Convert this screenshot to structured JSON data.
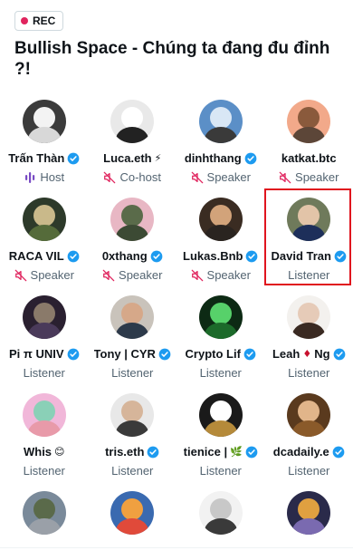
{
  "rec_badge": {
    "label": "REC",
    "dot_color": "#e0245e"
  },
  "space_title": "Bullish Space - Chúng ta đang đu đỉnh ?!",
  "colors": {
    "verified": "#1d9bf0",
    "host_accent": "#794bc4",
    "muted": "#536471",
    "highlight": "#e0141e"
  },
  "participants": [
    {
      "name": "Trấn Thàn",
      "role": "Host",
      "role_icon": "host-speaking-bars-icon",
      "verified": true,
      "avatar": [
        "#3b3b3b",
        "#f3f3f3",
        "#d8d8d8"
      ]
    },
    {
      "name": "Luca.eth",
      "emoji": "⚡",
      "role": "Co-host",
      "role_icon": "mic-muted-icon",
      "verified": false,
      "avatar": [
        "#e9e9e9",
        "#ffffff",
        "#222222"
      ]
    },
    {
      "name": "dinhthang",
      "role": "Speaker",
      "role_icon": "mic-muted-icon",
      "verified": true,
      "avatar": [
        "#5b8fc7",
        "#d9e7f5",
        "#3a3a3a"
      ]
    },
    {
      "name": "katkat.btc",
      "role": "Speaker",
      "role_icon": "mic-muted-icon",
      "verified": false,
      "avatar": [
        "#f2a98a",
        "#8a5a3c",
        "#5c4638"
      ]
    },
    {
      "name": "RACA VIL",
      "role": "Speaker",
      "role_icon": "mic-muted-icon",
      "verified": true,
      "avatar": [
        "#2d3a2a",
        "#c9b98a",
        "#556b3a"
      ]
    },
    {
      "name": "0xthang",
      "role": "Speaker",
      "role_icon": "mic-muted-icon",
      "verified": true,
      "avatar": [
        "#e8b7c4",
        "#5a6b4a",
        "#3c4a34"
      ]
    },
    {
      "name": "Lukas.Bnb",
      "role": "Speaker",
      "role_icon": "mic-muted-icon",
      "verified": true,
      "avatar": [
        "#3a2c22",
        "#d2a37a",
        "#2a2420"
      ]
    },
    {
      "name": "David Tran",
      "role": "Listener",
      "verified": true,
      "avatar": [
        "#6f7a5b",
        "#e2c4a8",
        "#1d2f5a"
      ]
    },
    {
      "name": "Pi π UNIV",
      "role": "Listener",
      "verified": true,
      "avatar": [
        "#2a2030",
        "#8a7a6a",
        "#4a3a5a"
      ]
    },
    {
      "name": "Tony | CYR",
      "role": "Listener",
      "verified": true,
      "avatar": [
        "#c9c3bb",
        "#d6a889",
        "#2d3a4a"
      ]
    },
    {
      "name": "Crypto Lif",
      "role": "Listener",
      "verified": true,
      "avatar": [
        "#0d2a14",
        "#57d16a",
        "#1c6a2a"
      ]
    },
    {
      "name": "Leah",
      "emoji": "♦",
      "name_suffix": "Ng",
      "role": "Listener",
      "verified": true,
      "avatar": [
        "#f3f1ee",
        "#e6cbb8",
        "#3a2a22"
      ]
    },
    {
      "name": "Whis",
      "emoji": "😊",
      "role": "Listener",
      "verified": false,
      "avatar": [
        "#f1b7d9",
        "#8ad0b7",
        "#e89aa9"
      ]
    },
    {
      "name": "tris.eth",
      "role": "Listener",
      "verified": true,
      "avatar": [
        "#e8e8e8",
        "#d6b59a",
        "#3a3a3a"
      ]
    },
    {
      "name": "tienice |",
      "emoji": "🌿",
      "role": "Listener",
      "verified": true,
      "avatar": [
        "#1a1a1a",
        "#ffffff",
        "#b58a3a"
      ]
    },
    {
      "name": "dcadaily.e",
      "role": "Listener",
      "verified": true,
      "avatar": [
        "#5a3a1e",
        "#e1b58a",
        "#8a5a2a"
      ]
    },
    {
      "name": "",
      "role": "",
      "verified": false,
      "avatar": [
        "#7a8a9a",
        "#5a6a4a",
        "#9aa0a8"
      ]
    },
    {
      "name": "",
      "role": "",
      "verified": false,
      "avatar": [
        "#3a6ab0",
        "#f0a040",
        "#e04a3a"
      ]
    },
    {
      "name": "",
      "role": "",
      "verified": false,
      "avatar": [
        "#f2f2f2",
        "#c8c8c8",
        "#3a3a3a"
      ]
    },
    {
      "name": "",
      "role": "",
      "verified": false,
      "avatar": [
        "#2a2a4a",
        "#e0a040",
        "#7a6ab0"
      ]
    }
  ]
}
